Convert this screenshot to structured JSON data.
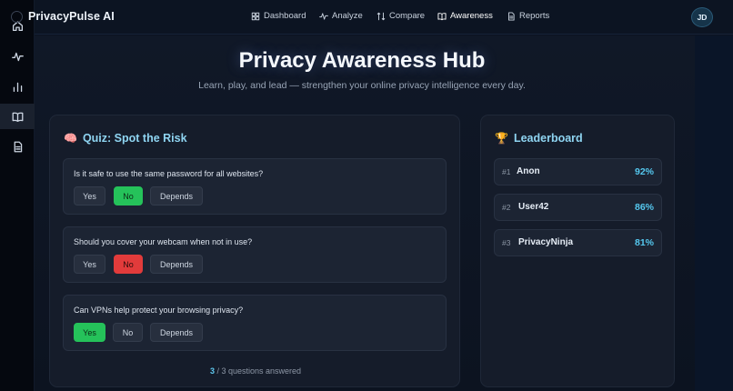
{
  "app": {
    "brand": "PrivacyPulse AI",
    "avatar_initials": "JD"
  },
  "nav": [
    {
      "label": "Dashboard",
      "icon": "dashboard-grid-icon"
    },
    {
      "label": "Analyze",
      "icon": "pulse-icon"
    },
    {
      "label": "Compare",
      "icon": "compare-arrows-icon"
    },
    {
      "label": "Awareness",
      "icon": "book-icon",
      "active": true
    },
    {
      "label": "Reports",
      "icon": "document-icon"
    }
  ],
  "sidebar": [
    {
      "icon": "home-icon"
    },
    {
      "icon": "pulse-icon"
    },
    {
      "icon": "bar-chart-icon"
    },
    {
      "icon": "book-icon",
      "active": true
    },
    {
      "icon": "document-icon"
    }
  ],
  "hero": {
    "title": "Privacy Awareness Hub",
    "subtitle": "Learn, play, and lead — strengthen your online privacy intelligence every day."
  },
  "quiz": {
    "title": "Quiz: Spot the Risk",
    "emoji": "🧠",
    "questions": [
      {
        "text": "Is it safe to use the same password for all websites?",
        "options": [
          "Yes",
          "No",
          "Depends"
        ],
        "selected": "No",
        "result": "correct"
      },
      {
        "text": "Should you cover your webcam when not in use?",
        "options": [
          "Yes",
          "No",
          "Depends"
        ],
        "selected": "No",
        "result": "wrong"
      },
      {
        "text": "Can VPNs help protect your browsing privacy?",
        "options": [
          "Yes",
          "No",
          "Depends"
        ],
        "selected": "Yes",
        "result": "correct"
      }
    ],
    "progress": {
      "answered": "3",
      "rest": " / 3 questions answered"
    }
  },
  "leaderboard": {
    "title": "Leaderboard",
    "emoji": "🏆",
    "rows": [
      {
        "rank": "#1",
        "name": "Anon",
        "score": "92%"
      },
      {
        "rank": "#2",
        "name": "User42",
        "score": "86%"
      },
      {
        "rank": "#3",
        "name": "PrivacyNinja",
        "score": "81%"
      }
    ]
  },
  "colors": {
    "accent": "#55c8ef",
    "correct": "#25c25a",
    "wrong": "#e23b3b"
  }
}
